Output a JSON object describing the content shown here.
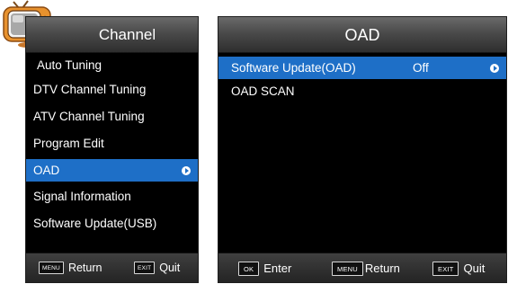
{
  "left_menu": {
    "title": "Channel",
    "items": [
      {
        "label": "Auto Tuning"
      },
      {
        "label": "DTV Channel Tuning"
      },
      {
        "label": "ATV Channel Tuning"
      },
      {
        "label": "Program Edit"
      },
      {
        "label": "OAD"
      },
      {
        "label": "Signal Information"
      },
      {
        "label": "Software Update(USB)"
      }
    ],
    "selected_index": 4,
    "footer": [
      {
        "key": "MENU",
        "label": "Return"
      },
      {
        "key": "EXIT",
        "label": "Quit"
      }
    ]
  },
  "right_menu": {
    "title": "OAD",
    "items": [
      {
        "label": "Software Update(OAD)",
        "value": "Off"
      },
      {
        "label": "OAD SCAN",
        "value": ""
      }
    ],
    "selected_index": 0,
    "footer": [
      {
        "key": "OK",
        "label": "Enter"
      },
      {
        "key": "MENU",
        "label": "Return"
      },
      {
        "key": "EXIT",
        "label": "Quit"
      }
    ]
  },
  "colors": {
    "panel_bg": "#000000",
    "header": "#4a4a4a",
    "highlight": "#1e6fc7",
    "text": "#ffffff"
  },
  "icons": [
    "tv-icon",
    "arrow-right-icon"
  ]
}
